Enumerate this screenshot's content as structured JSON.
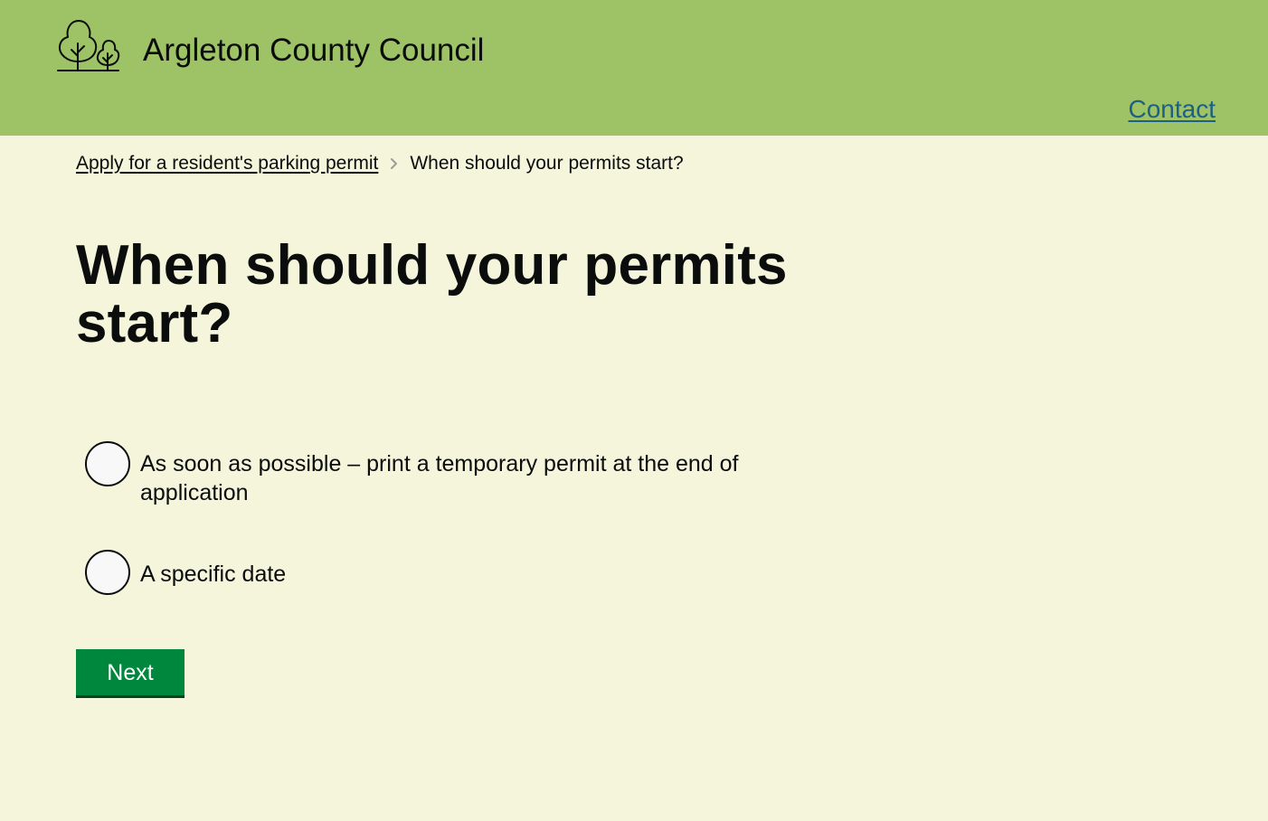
{
  "header": {
    "council_name": "Argleton County Council",
    "logo_icon": "trees-icon",
    "background_color": "#9dc366",
    "contact_label": "Contact",
    "contact_color": "#1d5f86"
  },
  "breadcrumb": {
    "parent_label": "Apply for a resident's parking permit",
    "separator_icon": "chevron-right-icon",
    "current_label": "When should your permits start?"
  },
  "main": {
    "title": "When should your permits start?",
    "options": [
      {
        "label": "As soon as possible – print a temporary permit at the end of application",
        "selected": false
      },
      {
        "label": "A specific date",
        "selected": false
      }
    ],
    "next_label": "Next",
    "button_color": "#00873e"
  },
  "page": {
    "background_color": "#f4f5da"
  }
}
